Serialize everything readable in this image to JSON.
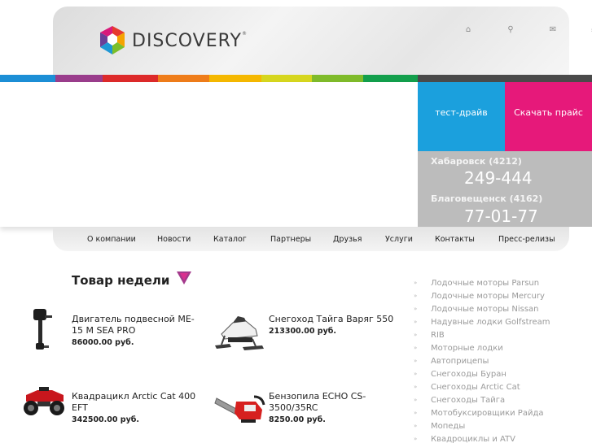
{
  "header": {
    "logo_text": "Discovery",
    "logo_reg": "®",
    "top_icons": [
      {
        "name": "home-icon",
        "glyph": "⌂"
      },
      {
        "name": "search-icon",
        "glyph": "⚲"
      },
      {
        "name": "mail-icon",
        "glyph": "✉"
      },
      {
        "name": "sitemap-icon",
        "glyph": "⁂"
      }
    ]
  },
  "stripe_colors": [
    "#1c8fd6",
    "#9a3d8c",
    "#dd2a2a",
    "#ef7d1a",
    "#f5b800",
    "#d6d61e",
    "#7fbb2a",
    "#139f4c",
    "#4a4a4a"
  ],
  "buttons": {
    "test_drive": "тест-драйв",
    "price": "Скачать прайс"
  },
  "contacts": {
    "city1": "Хабаровск (4212)",
    "phone1": "249-444",
    "city2": "Благовещенск (4162)",
    "phone2": "77-01-77"
  },
  "nav": [
    "О компании",
    "Новости",
    "Каталог",
    "Партнеры",
    "Друзья",
    "Услуги",
    "Контакты",
    "Пресс-релизы"
  ],
  "week": {
    "title": "Товар недели"
  },
  "products": [
    {
      "name": "Двигатель подвесной ME- 15 M SEA PRO",
      "price": "86000.00 руб."
    },
    {
      "name": "Снегоход Тайга Варяг 550",
      "price": "213300.00 руб."
    },
    {
      "name": "Квадрацикл Arctic Cat 400 EFT",
      "price": "342500.00 руб."
    },
    {
      "name": "Бензопила ECHO CS-3500/35RC",
      "price": "8250.00 руб."
    }
  ],
  "side_bullet": "»",
  "side_list": [
    "Лодочные моторы Parsun",
    "Лодочные моторы Mercury",
    "Лодочные моторы Nissan",
    "Надувные лодки Golfstream",
    "RIB",
    "Моторные лодки",
    "Автоприцепы",
    "Снегоходы Буран",
    "Снегоходы Arctic Cat",
    "Снегоходы Тайга",
    "Мотобуксировщики Райда",
    "Мопеды",
    "Квадроциклы и ATV"
  ]
}
